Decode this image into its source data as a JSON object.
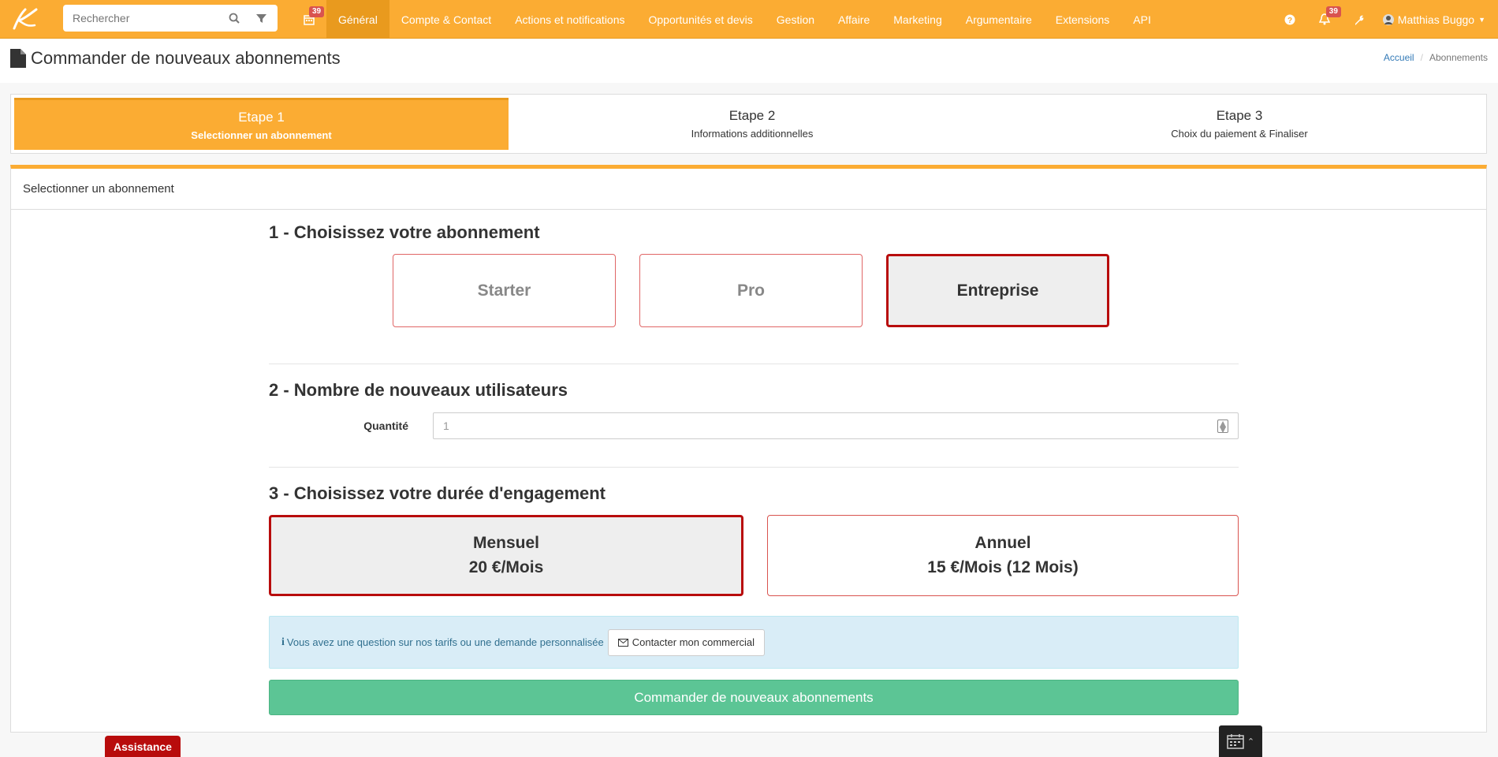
{
  "nav": {
    "search_placeholder": "Rechercher",
    "calendar_badge": "39",
    "items": [
      "Général",
      "Compte & Contact",
      "Actions et notifications",
      "Opportunités et devis",
      "Gestion",
      "Affaire",
      "Marketing",
      "Argumentaire",
      "Extensions",
      "API"
    ],
    "active_item": "Général",
    "notif_badge": "39",
    "user_name": "Matthias Buggo"
  },
  "page": {
    "title": "Commander de nouveaux abonnements",
    "breadcrumb": [
      "Accueil",
      "Abonnements"
    ]
  },
  "steps": [
    {
      "title": "Etape 1",
      "desc": "Selectionner un abonnement"
    },
    {
      "title": "Etape 2",
      "desc": "Informations additionnelles"
    },
    {
      "title": "Etape 3",
      "desc": "Choix du paiement & Finaliser"
    }
  ],
  "panel": {
    "heading": "Selectionner un abonnement",
    "section1": "1 - Choisissez votre abonnement",
    "plans": [
      "Starter",
      "Pro",
      "Entreprise"
    ],
    "selected_plan": "Entreprise",
    "section2": "2 - Nombre de nouveaux utilisateurs",
    "quantity_label": "Quantité",
    "quantity_value": "1",
    "section3": "3 - Choisissez votre durée d'engagement",
    "durations": [
      {
        "name": "Mensuel",
        "price": "20 €/Mois"
      },
      {
        "name": "Annuel",
        "price": "15 €/Mois (12 Mois)"
      }
    ],
    "selected_duration": "Mensuel",
    "alert_text": "Vous avez une question sur nos tarifs ou une demande personnalisée",
    "contact_button": "Contacter mon commercial",
    "order_button": "Commander de nouveaux abonnements"
  },
  "widgets": {
    "assistance": "Assistance"
  }
}
